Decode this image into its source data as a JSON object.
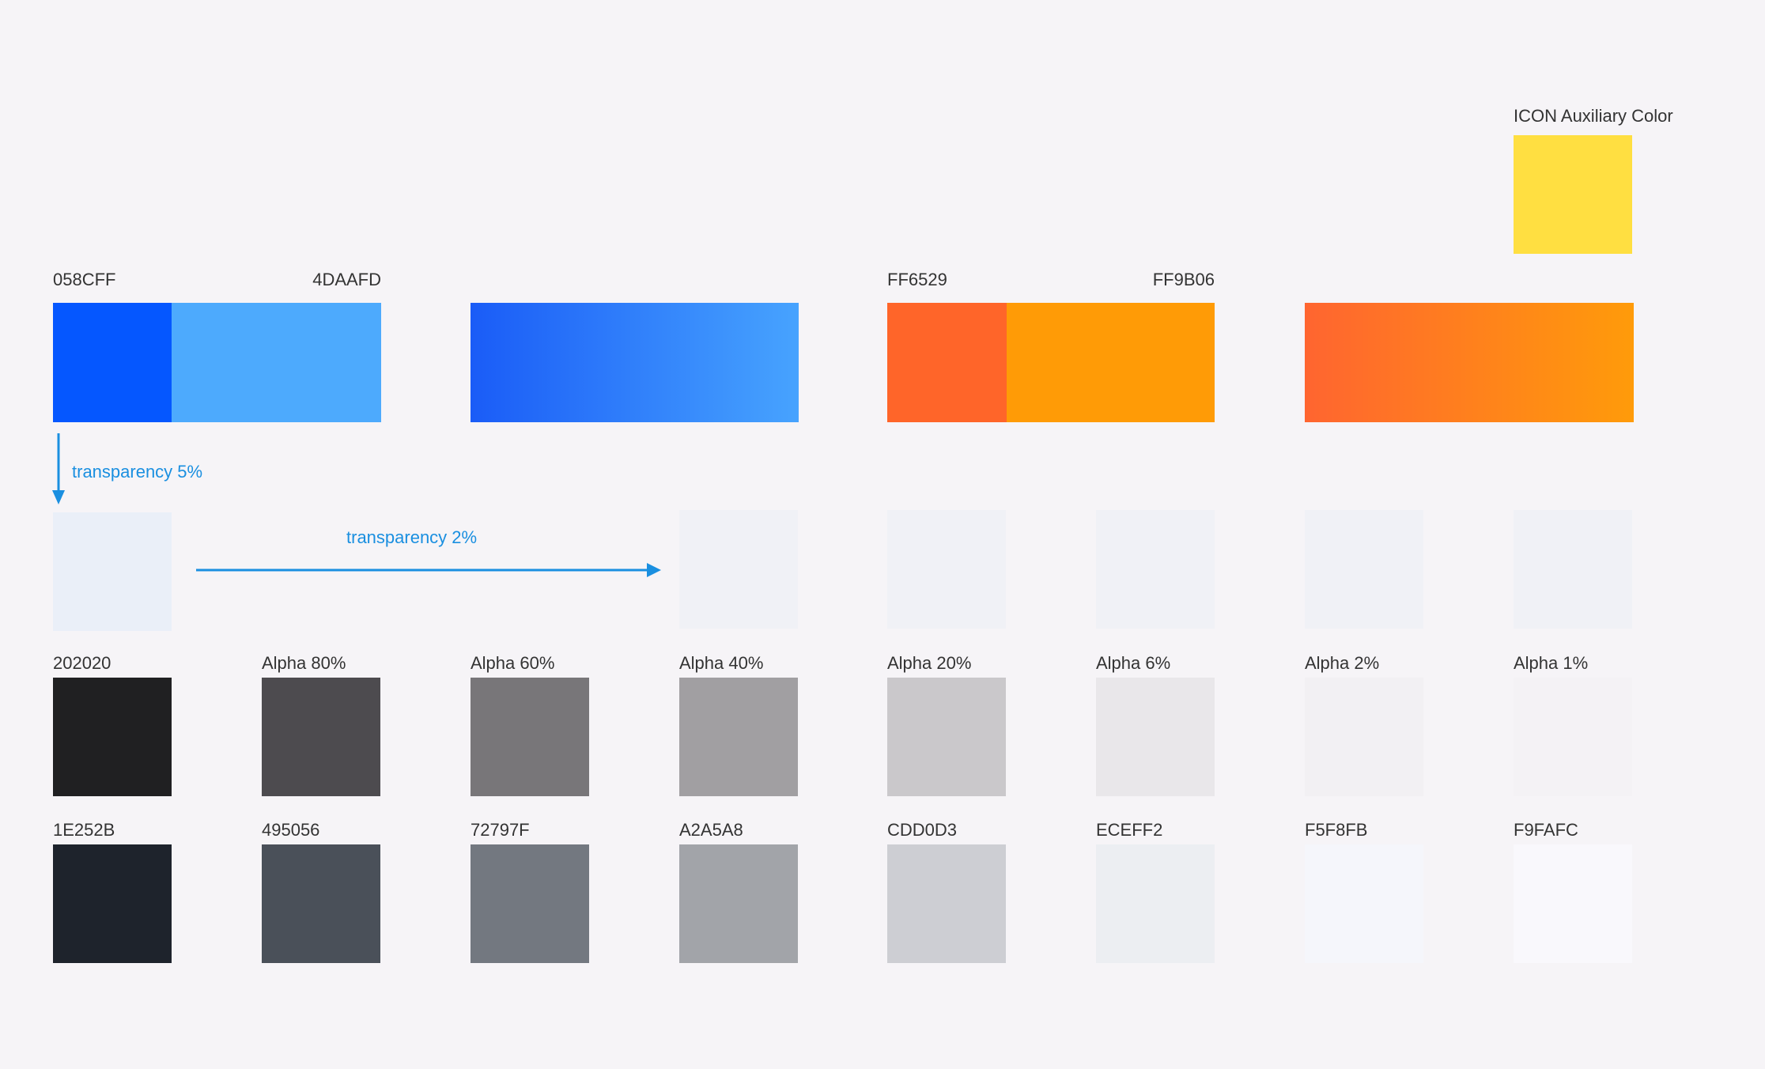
{
  "icon_auxiliary": {
    "label": "ICON Auxiliary Color",
    "color": "#FFDF41"
  },
  "blue_pair": {
    "left_label": "058CFF",
    "right_label": "4DAAFD",
    "left_color": "#0557FF",
    "right_color": "#4DAAFD"
  },
  "blue_gradient": {
    "from": "#1A5CF7",
    "to": "#47A3FE"
  },
  "orange_pair": {
    "left_label": "FF6529",
    "right_label": "FF9B06",
    "left_color": "#FF6529",
    "right_color": "#FF9B06"
  },
  "orange_gradient": {
    "from": "#FF6530",
    "to": "#FF9B0A"
  },
  "annotations": {
    "transparency_5": "transparency 5%",
    "transparency_2": "transparency 2%",
    "arrow_color": "#1A8FE0"
  },
  "tint_swatches": {
    "first_color": "#EAEFF8",
    "rest_color": "#F0F1F6"
  },
  "alpha_row": [
    {
      "label": "202020",
      "color": "#202022"
    },
    {
      "label": "Alpha 80%",
      "color": "#4D4B4F"
    },
    {
      "label": "Alpha 60%",
      "color": "#787679"
    },
    {
      "label": "Alpha 40%",
      "color": "#A19FA2"
    },
    {
      "label": "Alpha 20%",
      "color": "#CAC8CB"
    },
    {
      "label": "Alpha 6%",
      "color": "#E9E7EA"
    },
    {
      "label": "Alpha 2%",
      "color": "#F2F0F3"
    },
    {
      "label": "Alpha 1%",
      "color": "#F4F2F5"
    }
  ],
  "neutral_row": [
    {
      "label": "1E252B",
      "color": "#1E232C"
    },
    {
      "label": "495056",
      "color": "#4A5059"
    },
    {
      "label": "72797F",
      "color": "#737880"
    },
    {
      "label": "A2A5A8",
      "color": "#A2A4A9"
    },
    {
      "label": "CDD0D3",
      "color": "#CDCED3"
    },
    {
      "label": "ECEFF2",
      "color": "#ECEEF2"
    },
    {
      "label": "F5F8FB",
      "color": "#F5F6FB"
    },
    {
      "label": "F9FAFC",
      "color": "#F9F8FC"
    }
  ]
}
